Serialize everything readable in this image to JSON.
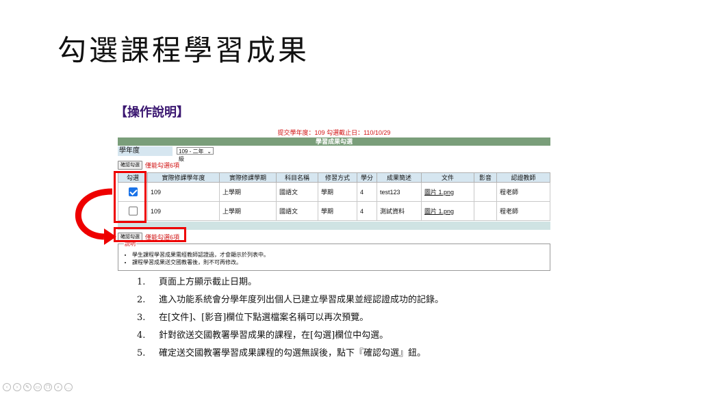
{
  "slide": {
    "title": "勾選課程學習成果",
    "section_heading": "【操作說明】"
  },
  "form": {
    "deadline_text": "提交學年度：109 勾選截止日：110/10/29",
    "header_title": "學習成果勾選",
    "year_label": "學年度",
    "year_select_value": "109 - 二年級",
    "confirm_button_label": "確認勾選",
    "limit_note": "僅能勾選6項",
    "columns": [
      "勾選",
      "實際修課學年度",
      "實際修課學期",
      "科目名稱",
      "修習方式",
      "學分",
      "成果簡述",
      "文件",
      "影音",
      "認證教師"
    ],
    "rows": [
      {
        "checked": true,
        "year": "109",
        "term": "上學期",
        "subject": "國語文",
        "mode": "學期",
        "credits": "4",
        "summary": "test123",
        "file": "圖片 1.png",
        "video": "",
        "teacher": "程老師"
      },
      {
        "checked": false,
        "year": "109",
        "term": "上學期",
        "subject": "國語文",
        "mode": "學期",
        "credits": "4",
        "summary": "測試資料",
        "file": "圖片 1.png",
        "video": "",
        "teacher": "程老師"
      }
    ],
    "notes_title": "說明",
    "notes": [
      "學生課程學習成果需經教師認證過，才會顯示於列表中。",
      "課程學習成果送交國教署後，則不可再修改。"
    ]
  },
  "steps": [
    {
      "num": "1.",
      "text": "頁面上方顯示截止日期。"
    },
    {
      "num": "2.",
      "text": "進入功能系統會分學年度列出個人已建立學習成果並經認證成功的記錄。"
    },
    {
      "num": "3.",
      "text": "在[文件]、[影音]欄位下點選檔案名稱可以再次預覽。"
    },
    {
      "num": "4.",
      "text": "針對欲送交國教署學習成果的課程，在[勾選]欄位中勾選。"
    },
    {
      "num": "5.",
      "text": "確定送交國教署學習成果課程的勾選無誤後，點下『確認勾選』鈕。"
    }
  ],
  "colors": {
    "highlight_red": "#e00000",
    "header_green": "#7a9e7a",
    "label_blue": "#d6e6f0",
    "heading_purple": "#3a1670"
  },
  "icons": [
    "previous-icon",
    "next-icon",
    "pen-icon",
    "eraser-icon",
    "copy-icon",
    "zoom-icon",
    "more-icon"
  ]
}
